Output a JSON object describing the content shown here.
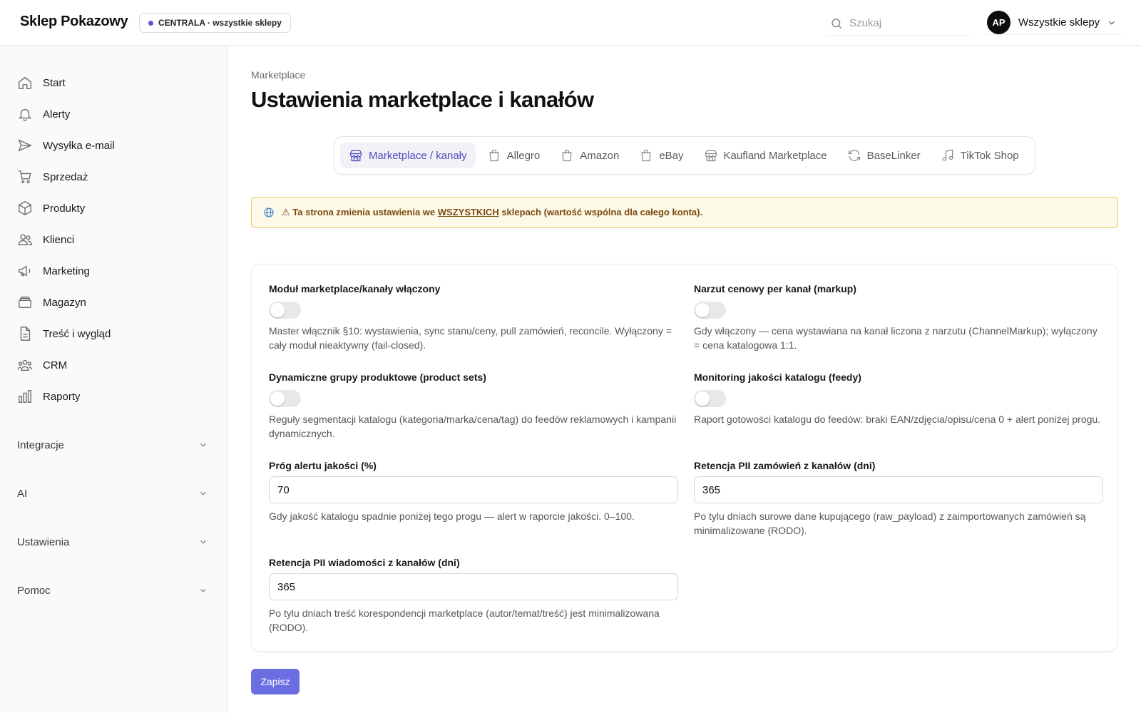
{
  "header": {
    "brand": "Sklep Pokazowy",
    "store_badge": "CENTRALA · wszystkie sklepy",
    "search_placeholder": "Szukaj",
    "avatar_initials": "AP",
    "store_selector": "Wszystkie sklepy"
  },
  "sidebar": {
    "items": [
      {
        "label": "Start",
        "icon": "home-icon"
      },
      {
        "label": "Alerty",
        "icon": "bell-icon"
      },
      {
        "label": "Wysyłka e-mail",
        "icon": "send-icon"
      },
      {
        "label": "Sprzedaż",
        "icon": "cart-icon"
      },
      {
        "label": "Produkty",
        "icon": "box-icon"
      },
      {
        "label": "Klienci",
        "icon": "users-icon"
      },
      {
        "label": "Marketing",
        "icon": "megaphone-icon"
      },
      {
        "label": "Magazyn",
        "icon": "archive-icon"
      },
      {
        "label": "Treść i wygląd",
        "icon": "document-icon"
      },
      {
        "label": "CRM",
        "icon": "group-icon"
      },
      {
        "label": "Raporty",
        "icon": "bar-chart-icon"
      }
    ],
    "groups": [
      {
        "label": "Integracje"
      },
      {
        "label": "AI"
      },
      {
        "label": "Ustawienia"
      },
      {
        "label": "Pomoc"
      }
    ]
  },
  "main": {
    "breadcrumb": "Marketplace",
    "title": "Ustawienia marketplace i kanałów",
    "tabs": [
      {
        "label": "Marketplace / kanały",
        "icon": "storefront-icon",
        "active": true
      },
      {
        "label": "Allegro",
        "icon": "shopping-bag-icon",
        "active": false
      },
      {
        "label": "Amazon",
        "icon": "shopping-bag-icon",
        "active": false
      },
      {
        "label": "eBay",
        "icon": "shopping-bag-icon",
        "active": false
      },
      {
        "label": "Kaufland Marketplace",
        "icon": "storefront-icon",
        "active": false
      },
      {
        "label": "BaseLinker",
        "icon": "refresh-icon",
        "active": false
      },
      {
        "label": "TikTok Shop",
        "icon": "music-note-icon",
        "active": false
      }
    ],
    "notice": {
      "prefix": "⚠ Ta strona zmienia ustawienia we ",
      "emphasis": "WSZYSTKICH",
      "suffix": " sklepach (wartość wspólna dla całego konta).",
      "color": "#fdf9e8",
      "border_color": "#ecc85a"
    },
    "settings": {
      "module_enabled": {
        "label": "Moduł marketplace/kanały włączony",
        "enabled": false,
        "help": "Master włącznik §10: wystawienia, sync stanu/ceny, pull zamówień, reconcile. Wyłączony = cały moduł nieaktywny (fail-closed)."
      },
      "channel_markup": {
        "label": "Narzut cenowy per kanał (markup)",
        "enabled": false,
        "help": "Gdy włączony — cena wystawiana na kanał liczona z narzutu (ChannelMarkup); wyłączony = cena katalogowa 1:1."
      },
      "product_sets": {
        "label": "Dynamiczne grupy produktowe (product sets)",
        "enabled": false,
        "help": "Reguły segmentacji katalogu (kategoria/marka/cena/tag) do feedów reklamowych i kampanii dynamicznych."
      },
      "catalog_quality": {
        "label": "Monitoring jakości katalogu (feedy)",
        "enabled": false,
        "help": "Raport gotowości katalogu do feedów: braki EAN/zdjęcia/opisu/cena 0 + alert poniżej progu."
      },
      "quality_threshold": {
        "label": "Próg alertu jakości (%)",
        "value": "70",
        "help": "Gdy jakość katalogu spadnie poniżej tego progu — alert w raporcie jakości. 0–100."
      },
      "order_pii_retention": {
        "label": "Retencja PII zamówień z kanałów (dni)",
        "value": "365",
        "help": "Po tylu dniach surowe dane kupującego (raw_payload) z zaimportowanych zamówień są minimalizowane (RODO)."
      },
      "message_pii_retention": {
        "label": "Retencja PII wiadomości z kanałów (dni)",
        "value": "365",
        "help": "Po tylu dniach treść korespondencji marketplace (autor/temat/treść) jest minimalizowana (RODO)."
      }
    },
    "save_label": "Zapisz",
    "accent_color": "#6b6ee0"
  }
}
